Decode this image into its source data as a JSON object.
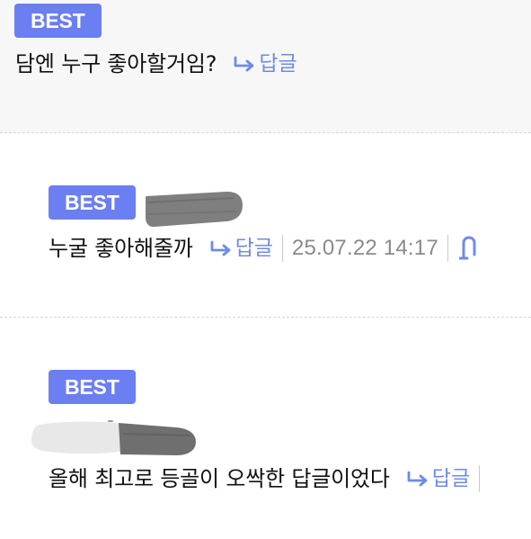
{
  "comments": [
    {
      "badge": "BEST",
      "text": "담엔 누구 좋아할거임?",
      "reply_label": "답글"
    },
    {
      "badge": "BEST",
      "text": "누굴 좋아해줄까",
      "reply_label": "답글",
      "date": "25.07.22 14:17"
    },
    {
      "badge": "BEST",
      "text": "올해 최고로 등골이 오싹한 답글이었다",
      "reply_label": "답글"
    }
  ],
  "icons": {
    "reply": "reply-arrow-icon",
    "attachment": "clip-icon"
  },
  "colors": {
    "badge_bg": "#6b7ff2",
    "badge_text": "#ffffff",
    "reply_text": "#6f8be6",
    "date_text": "#8a8a8a",
    "first_comment_bg": "#f7f7f7",
    "divider": "#d7d7d7"
  }
}
